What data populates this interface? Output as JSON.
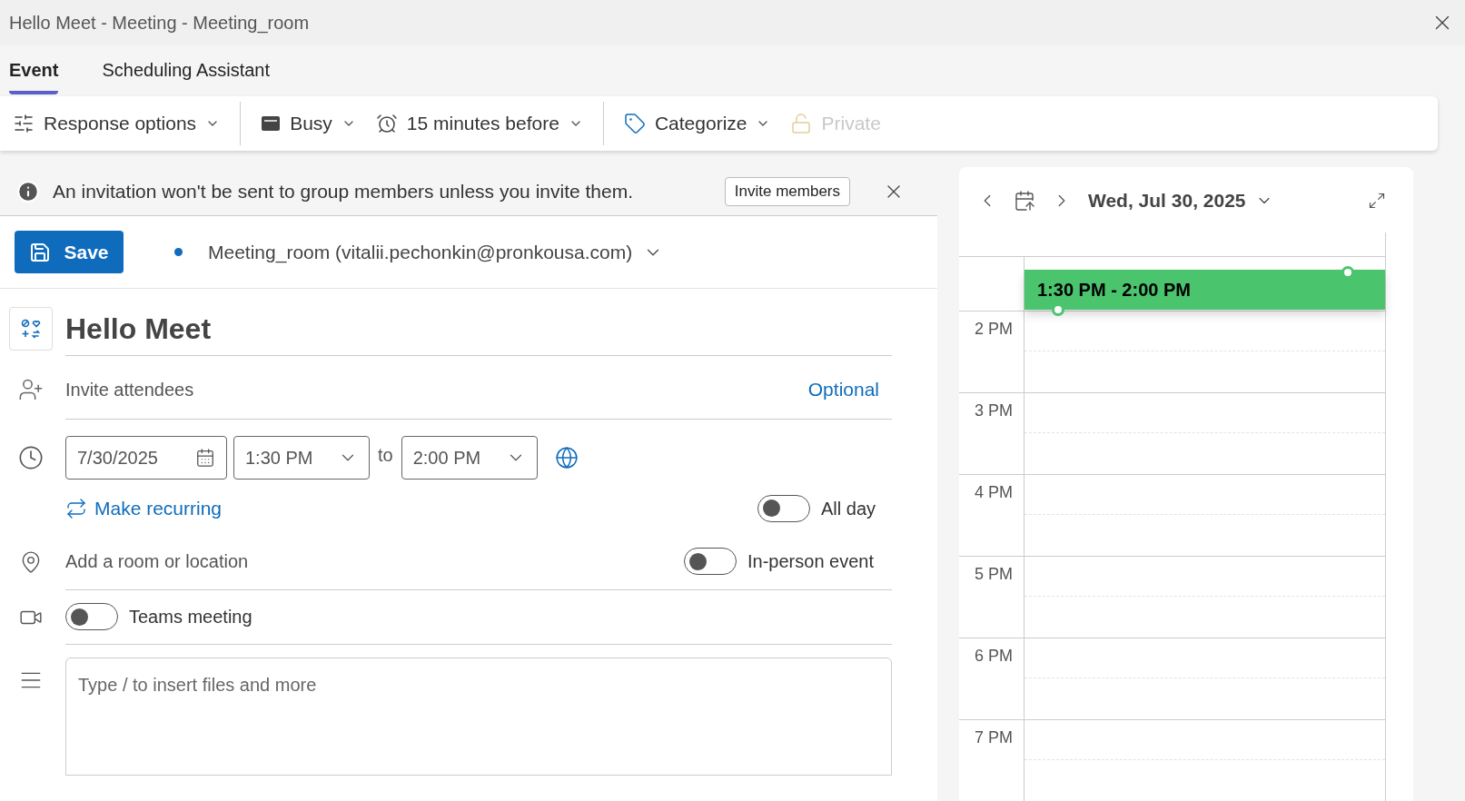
{
  "window": {
    "title": "Hello Meet - Meeting - Meeting_room"
  },
  "tabs": [
    {
      "label": "Event",
      "selected": true
    },
    {
      "label": "Scheduling Assistant",
      "selected": false
    }
  ],
  "toolbar": [
    {
      "label": "Response options",
      "disabled": false
    },
    {
      "label": "Busy",
      "disabled": false
    },
    {
      "label": "15 minutes before",
      "disabled": false
    },
    {
      "label": "Categorize",
      "disabled": false
    },
    {
      "label": "Private",
      "disabled": true
    }
  ],
  "banner": {
    "message": "An invitation won't be sent to group members unless you invite them.",
    "button": "Invite members"
  },
  "save_button": "Save",
  "calendar_account": "Meeting_room (vitalii.pechonkin@pronkousa.com)",
  "event_title": "Hello Meet",
  "attendees": {
    "placeholder": "Invite attendees",
    "optional_link": "Optional"
  },
  "time": {
    "date": "7/30/2025",
    "start": "1:30 PM",
    "separator": "to",
    "end": "2:00 PM"
  },
  "make_recurring": "Make recurring",
  "all_day": {
    "label": "All day",
    "on": false
  },
  "location": {
    "placeholder": "Add a room or location"
  },
  "in_person": {
    "label": "In-person event",
    "on": false
  },
  "teams": {
    "label": "Teams meeting",
    "on": false
  },
  "body": {
    "placeholder": "Type / to insert files and more"
  },
  "day_view": {
    "date": "Wed, Jul 30, 2025",
    "hours": [
      "2 PM",
      "3 PM",
      "4 PM",
      "5 PM",
      "6 PM",
      "7 PM"
    ],
    "event": {
      "time": "1:30 PM - 2:00 PM",
      "color": "#4bc46e"
    }
  }
}
